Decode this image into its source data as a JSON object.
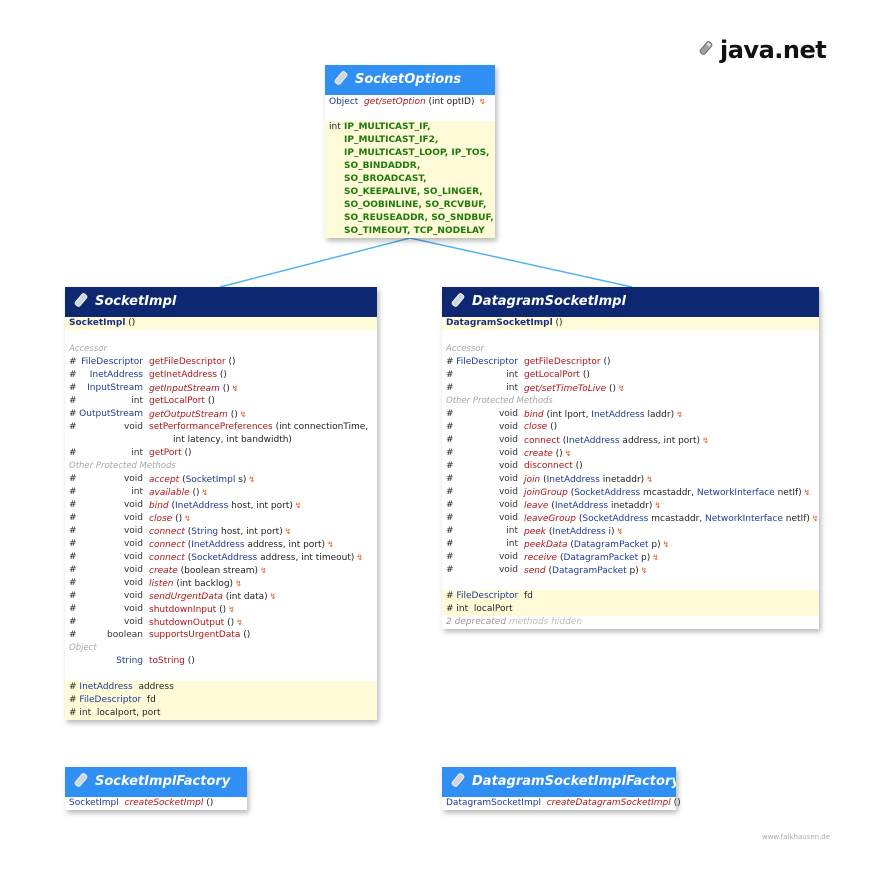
{
  "package": "java.net",
  "credit": "www.falkhausen.de",
  "colors": {
    "light_header": "#2f8ff2",
    "dark_header": "#0d2870",
    "field_bg": "#fffbd9",
    "connector": "#4fb4f0"
  },
  "socket_options": {
    "title": "SocketOptions",
    "method": {
      "type": "Object",
      "name": "get/setOption",
      "args": "(int optID)"
    },
    "const_type": "int",
    "constants": [
      "IP_MULTICAST_IF,",
      "IP_MULTICAST_IF2,",
      "IP_MULTICAST_LOOP, IP_TOS,",
      "SO_BINDADDR,",
      "SO_BROADCAST,",
      "SO_KEEPALIVE, SO_LINGER,",
      "SO_OOBINLINE, SO_RCVBUF,",
      "SO_REUSEADDR, SO_SNDBUF,",
      "SO_TIMEOUT, TCP_NODELAY"
    ]
  },
  "socket_impl": {
    "title": "SocketImpl",
    "constructor": "SocketImpl",
    "constructor_args": "()",
    "section_accessor": "Accessor",
    "accessor": [
      {
        "mod": "#",
        "type": "FileDescriptor",
        "name": "getFileDescriptor",
        "args": "()"
      },
      {
        "mod": "#",
        "type": "InetAddress",
        "name": "getInetAddress",
        "args": "()"
      },
      {
        "mod": "#",
        "type": "InputStream",
        "name": "getInputStream",
        "args": "()",
        "italic": true,
        "arrow": "↯"
      },
      {
        "mod": "#",
        "type": "int",
        "name": "getLocalPort",
        "args": "()"
      },
      {
        "mod": "#",
        "type": "OutputStream",
        "name": "getOutputStream",
        "args": "()",
        "italic": true,
        "arrow": "↯"
      },
      {
        "mod": "#",
        "type": "void",
        "name": "setPerformancePreferences",
        "args": "(int connectionTime,"
      },
      {
        "mod": "",
        "type": "",
        "name": "",
        "args": "int latency, int bandwidth)"
      },
      {
        "mod": "#",
        "type": "int",
        "name": "getPort",
        "args": "()"
      }
    ],
    "section_other": "Other Protected Methods",
    "other": [
      {
        "mod": "#",
        "type": "void",
        "name": "accept",
        "args": "(SocketImpl s)",
        "italic": true,
        "arrow": "↯"
      },
      {
        "mod": "#",
        "type": "int",
        "name": "available",
        "args": "()",
        "italic": true,
        "arrow": "↯"
      },
      {
        "mod": "#",
        "type": "void",
        "name": "bind",
        "args": "(InetAddress host, int port)",
        "italic": true,
        "arrow": "↯"
      },
      {
        "mod": "#",
        "type": "void",
        "name": "close",
        "args": "()",
        "italic": true,
        "arrow": "↯"
      },
      {
        "mod": "#",
        "type": "void",
        "name": "connect",
        "args": "(String host, int port)",
        "italic": true,
        "arrow": "↯"
      },
      {
        "mod": "#",
        "type": "void",
        "name": "connect",
        "args": "(InetAddress address, int port)",
        "italic": true,
        "arrow": "↯"
      },
      {
        "mod": "#",
        "type": "void",
        "name": "connect",
        "args": "(SocketAddress address, int timeout)",
        "italic": true,
        "arrow": "↯"
      },
      {
        "mod": "#",
        "type": "void",
        "name": "create",
        "args": "(boolean stream)",
        "italic": true,
        "arrow": "↯"
      },
      {
        "mod": "#",
        "type": "void",
        "name": "listen",
        "args": "(int backlog)",
        "italic": true,
        "arrow": "↯"
      },
      {
        "mod": "#",
        "type": "void",
        "name": "sendUrgentData",
        "args": "(int data)",
        "italic": true,
        "arrow": "↯"
      },
      {
        "mod": "#",
        "type": "void",
        "name": "shutdownInput",
        "args": "()",
        "arrow": "↯"
      },
      {
        "mod": "#",
        "type": "void",
        "name": "shutdownOutput",
        "args": "()",
        "arrow": "↯"
      },
      {
        "mod": "#",
        "type": "boolean",
        "name": "supportsUrgentData",
        "args": "()"
      }
    ],
    "section_object": "Object",
    "object": [
      {
        "mod": "",
        "type": "String",
        "name": "toString",
        "args": "()"
      }
    ],
    "fields": [
      {
        "mod": "#",
        "type": "InetAddress",
        "name": "address"
      },
      {
        "mod": "#",
        "type": "FileDescriptor",
        "name": "fd"
      },
      {
        "mod": "#",
        "type": "int",
        "name": "localport, port"
      }
    ]
  },
  "datagram_socket_impl": {
    "title": "DatagramSocketImpl",
    "constructor": "DatagramSocketImpl",
    "constructor_args": "()",
    "section_accessor": "Accessor",
    "accessor": [
      {
        "mod": "#",
        "type": "FileDescriptor",
        "name": "getFileDescriptor",
        "args": "()"
      },
      {
        "mod": "#",
        "type": "int",
        "name": "getLocalPort",
        "args": "()"
      },
      {
        "mod": "#",
        "type": "int",
        "name": "get/setTimeToLive",
        "args": "()",
        "italic": true,
        "arrow": "↯"
      }
    ],
    "section_other": "Other Protected Methods",
    "other": [
      {
        "mod": "#",
        "type": "void",
        "name": "bind",
        "args": "(int lport, InetAddress laddr)",
        "italic": true,
        "arrow": "↯"
      },
      {
        "mod": "#",
        "type": "void",
        "name": "close",
        "args": "()",
        "italic": true
      },
      {
        "mod": "#",
        "type": "void",
        "name": "connect",
        "args": "(InetAddress address, int port)",
        "arrow": "↯"
      },
      {
        "mod": "#",
        "type": "void",
        "name": "create",
        "args": "()",
        "italic": true,
        "arrow": "↯"
      },
      {
        "mod": "#",
        "type": "void",
        "name": "disconnect",
        "args": "()"
      },
      {
        "mod": "#",
        "type": "void",
        "name": "join",
        "args": "(InetAddress inetaddr)",
        "italic": true,
        "arrow": "↯"
      },
      {
        "mod": "#",
        "type": "void",
        "name": "joinGroup",
        "args": "(SocketAddress mcastaddr, NetworkInterface netIf)",
        "italic": true,
        "arrow": "↯"
      },
      {
        "mod": "#",
        "type": "void",
        "name": "leave",
        "args": "(InetAddress inetaddr)",
        "italic": true,
        "arrow": "↯"
      },
      {
        "mod": "#",
        "type": "void",
        "name": "leaveGroup",
        "args": "(SocketAddress mcastaddr, NetworkInterface netIf)",
        "italic": true,
        "arrow": "↯"
      },
      {
        "mod": "#",
        "type": "int",
        "name": "peek",
        "args": "(InetAddress i)",
        "italic": true,
        "arrow": "↯"
      },
      {
        "mod": "#",
        "type": "int",
        "name": "peekData",
        "args": "(DatagramPacket p)",
        "italic": true,
        "arrow": "↯"
      },
      {
        "mod": "#",
        "type": "void",
        "name": "receive",
        "args": "(DatagramPacket p)",
        "italic": true,
        "arrow": "↯"
      },
      {
        "mod": "#",
        "type": "void",
        "name": "send",
        "args": "(DatagramPacket p)",
        "italic": true,
        "arrow": "↯"
      }
    ],
    "fields": [
      {
        "mod": "#",
        "type": "FileDescriptor",
        "name": "fd"
      },
      {
        "mod": "#",
        "type": "int",
        "name": "localPort"
      }
    ],
    "footer_deprecated": "2 deprecated",
    "footer_hidden": "methods hidden"
  },
  "socket_impl_factory": {
    "title": "SocketImplFactory",
    "method": {
      "type": "SocketImpl",
      "name": "createSocketImpl",
      "args": "()"
    }
  },
  "datagram_socket_impl_factory": {
    "title": "DatagramSocketImplFactory",
    "method": {
      "type": "DatagramSocketImpl",
      "name": "createDatagramSocketImpl",
      "args": "()"
    }
  }
}
